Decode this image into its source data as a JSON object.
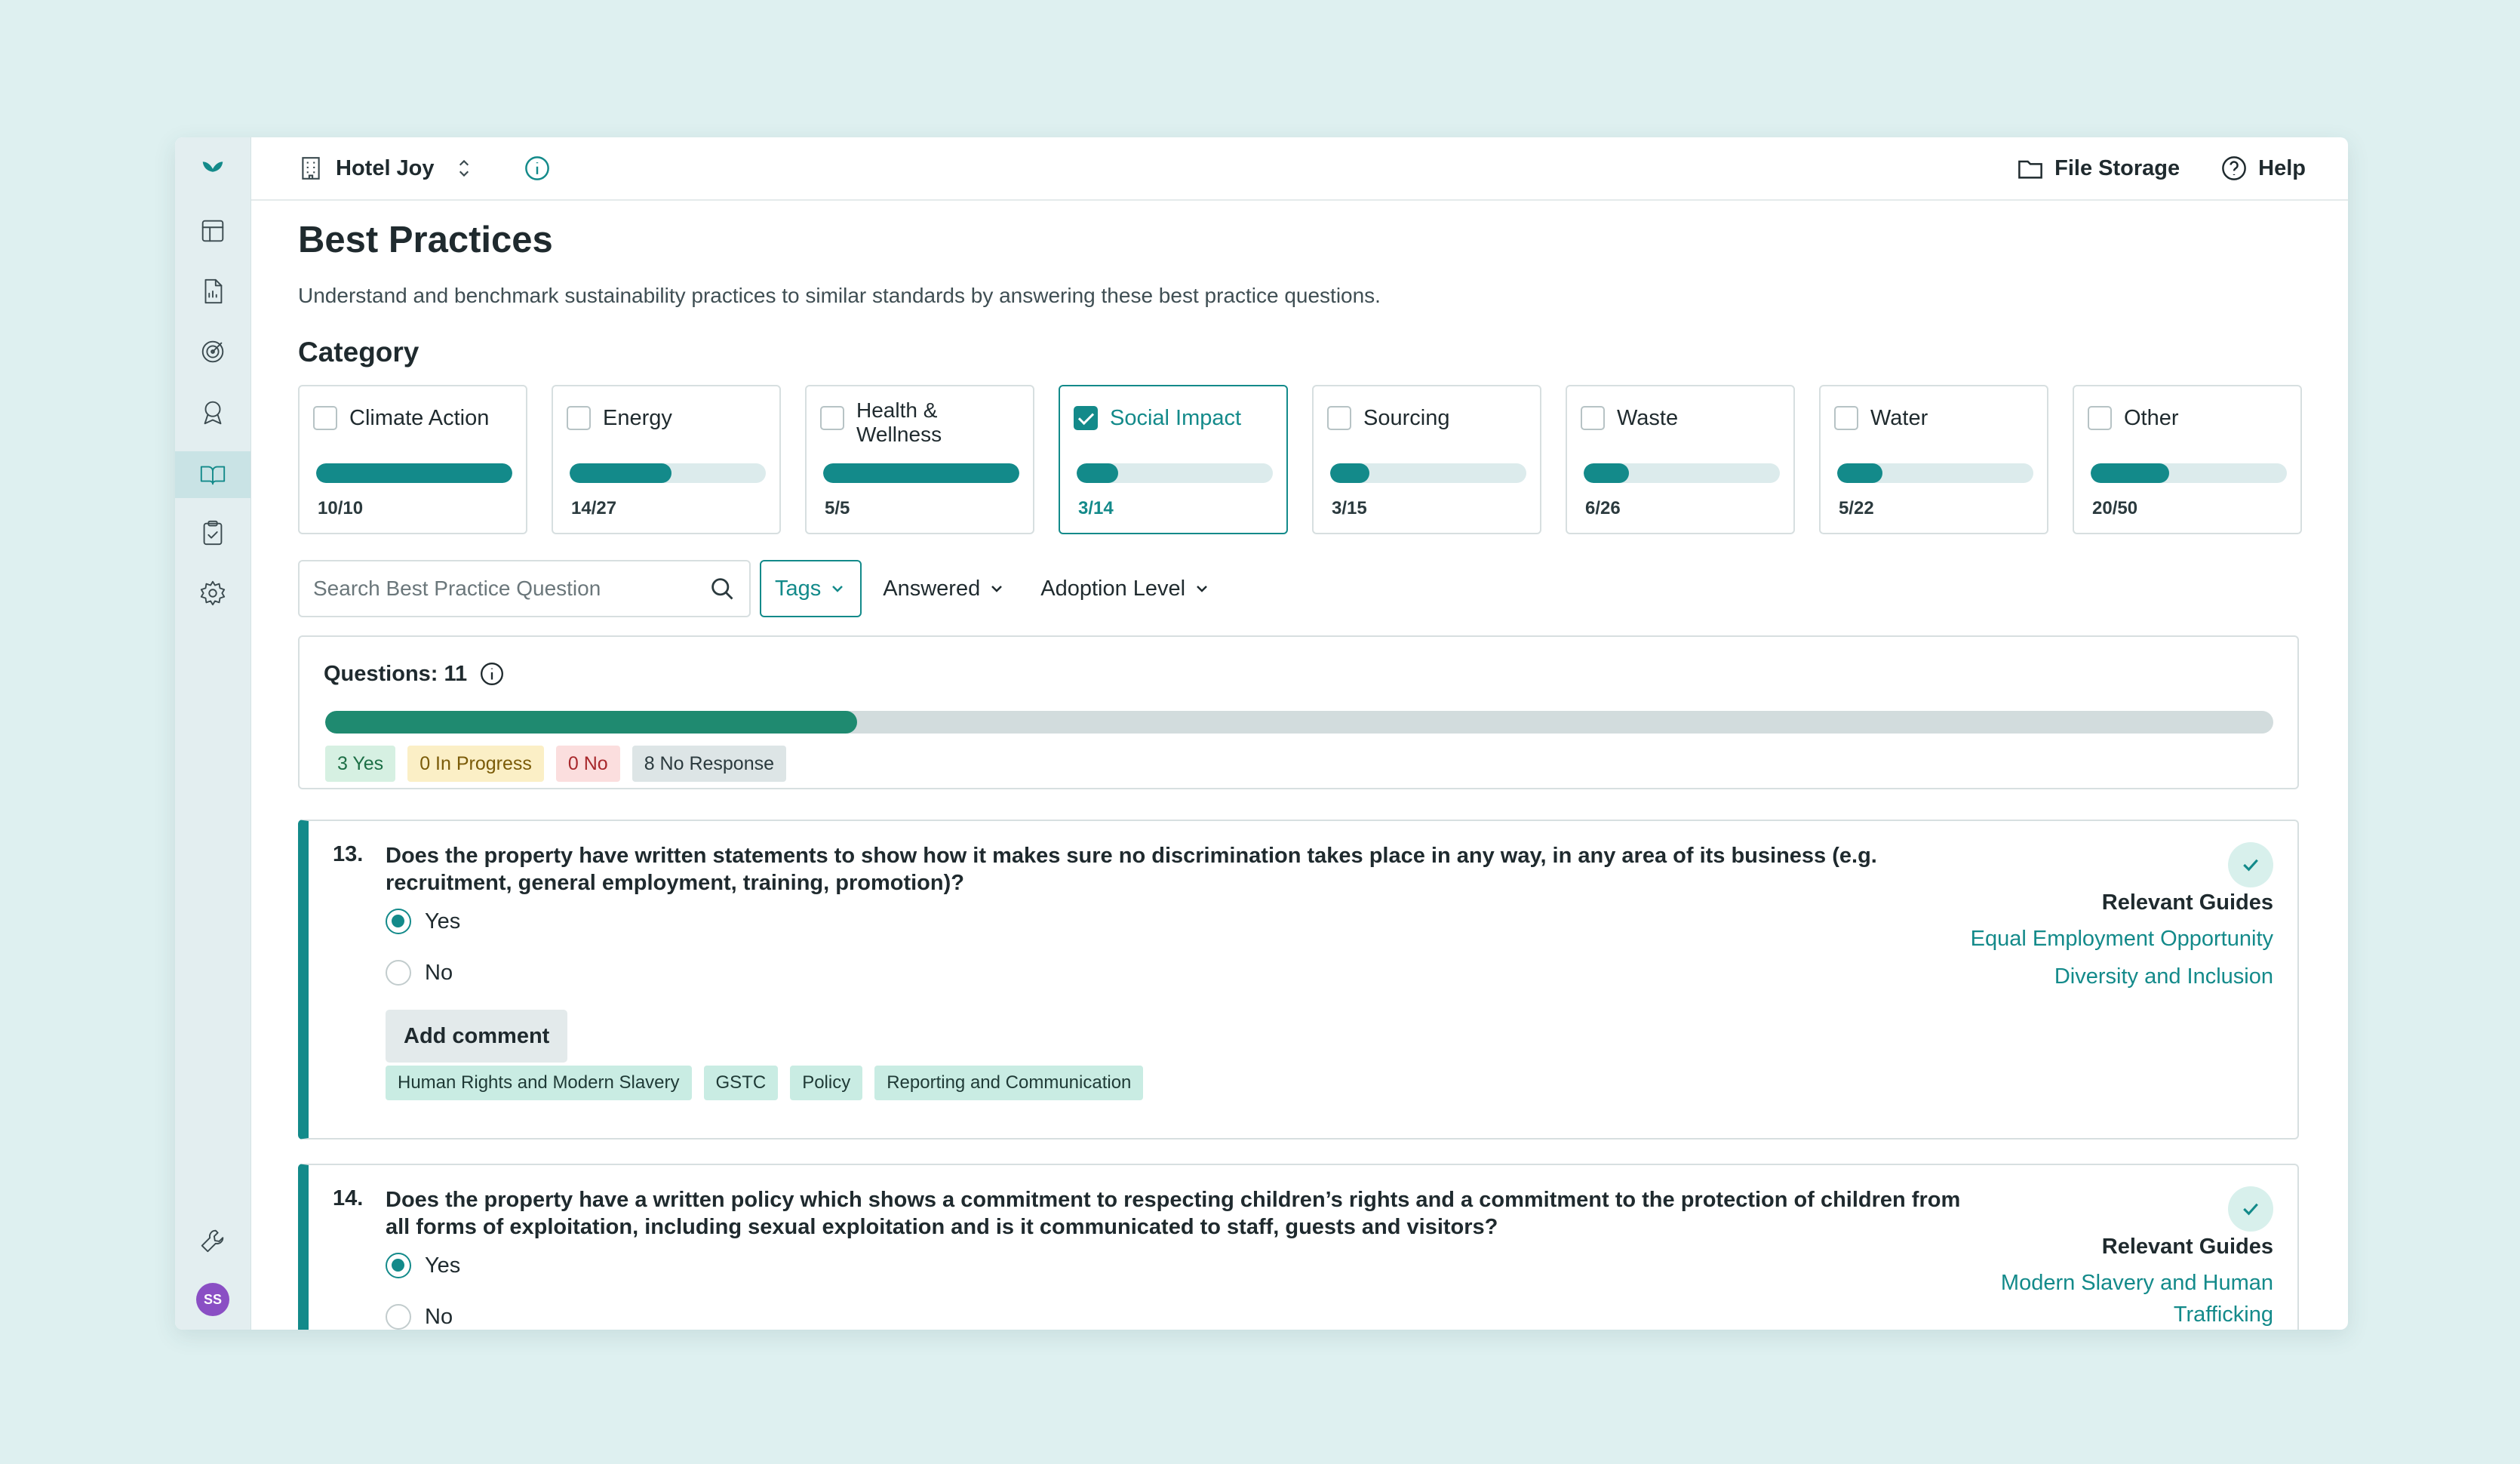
{
  "sidebar": {
    "items": [
      "logo-icon",
      "dashboard-icon",
      "report-icon",
      "target-icon",
      "award-icon",
      "book-icon",
      "clipboard-icon",
      "gear-icon"
    ],
    "bottom": [
      "tools-icon"
    ],
    "avatar_initials": "SS"
  },
  "header": {
    "property_name": "Hotel Joy",
    "file_storage": "File Storage",
    "help": "Help"
  },
  "page": {
    "title": "Best Practices",
    "subtitle": "Understand and benchmark sustainability practices to similar standards by answering these best practice questions.",
    "category_title": "Category"
  },
  "categories": [
    {
      "label": "Climate Action",
      "count": "10/10",
      "progress": 1.0,
      "selected": false
    },
    {
      "label": "Energy",
      "count": "14/27",
      "progress": 0.52,
      "selected": false
    },
    {
      "label": "Health & Wellness",
      "count": "5/5",
      "progress": 1.0,
      "selected": false
    },
    {
      "label": "Social Impact",
      "count": "3/14",
      "progress": 0.21,
      "selected": true
    },
    {
      "label": "Sourcing",
      "count": "3/15",
      "progress": 0.2,
      "selected": false
    },
    {
      "label": "Waste",
      "count": "6/26",
      "progress": 0.23,
      "selected": false
    },
    {
      "label": "Water",
      "count": "5/22",
      "progress": 0.23,
      "selected": false
    },
    {
      "label": "Other",
      "count": "20/50",
      "progress": 0.4,
      "selected": false
    }
  ],
  "filters": {
    "search_placeholder": "Search Best Practice Question",
    "tags": "Tags",
    "answered": "Answered",
    "adoption": "Adoption Level"
  },
  "summary": {
    "label": "Questions: 11",
    "progress": 0.273,
    "yes": "3 Yes",
    "in_progress": "0 In Progress",
    "no": "0 No",
    "no_response": "8 No Response"
  },
  "questions": [
    {
      "number": "13.",
      "text": "Does the property have written statements to show how it makes sure no discrimination takes place in any way, in any area of its business (e.g. recruitment, general employment, training, promotion)?",
      "yes": "Yes",
      "no": "No",
      "comment": "Add comment",
      "tags": [
        "Human Rights and Modern Slavery",
        "GSTC",
        "Policy",
        "Reporting and Communication"
      ],
      "guides_title": "Relevant Guides",
      "guides": [
        "Equal Employment Opportunity",
        "Diversity and Inclusion"
      ]
    },
    {
      "number": "14.",
      "text": "Does the property have a written policy which shows a commitment to respecting children’s rights and a commitment to the protection of children from all forms of exploitation, including sexual exploitation and is it communicated to staff, guests and visitors?",
      "yes": "Yes",
      "no": "No",
      "guides_title": "Relevant Guides",
      "guides": [
        "Modern Slavery and Human Trafficking"
      ]
    }
  ]
}
